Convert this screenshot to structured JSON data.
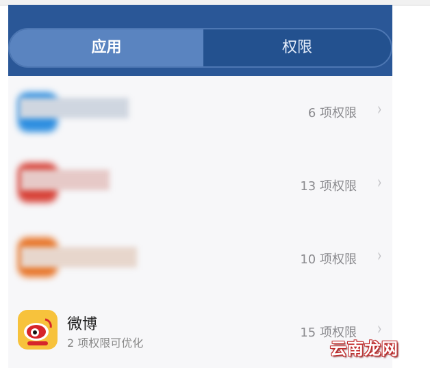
{
  "tabs": [
    {
      "label": "应用",
      "active": true
    },
    {
      "label": "权限",
      "active": false
    }
  ],
  "apps": [
    {
      "name": "",
      "perm_text": "6 项权限",
      "icon": "blurred-blue-app-icon",
      "color": "#2f8fe0"
    },
    {
      "name": "",
      "perm_text": "13 项权限",
      "icon": "blurred-red-app-icon",
      "color": "#d8443a"
    },
    {
      "name": "",
      "perm_text": "10 项权限",
      "icon": "blurred-orange-app-icon",
      "color": "#e8762a"
    },
    {
      "name": "微博",
      "subtitle": "2 项权限可优化",
      "perm_text": "15 项权限",
      "icon": "weibo-icon",
      "color": "#f7c23c"
    }
  ],
  "chevron": "›",
  "watermark": "云南龙网",
  "colors": {
    "header": "#2a5797",
    "active_tab": "#5a84c0"
  }
}
